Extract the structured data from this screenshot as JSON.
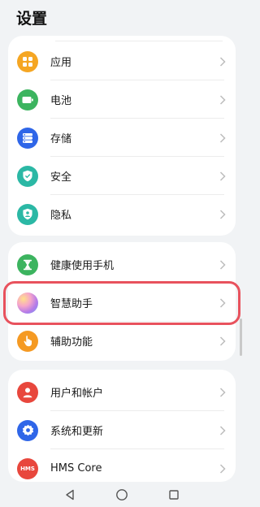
{
  "page": {
    "title": "设置"
  },
  "groups": [
    {
      "items": [
        {
          "label": "应用",
          "icon": "apps-icon",
          "color": "#f5a623"
        },
        {
          "label": "电池",
          "icon": "battery-icon",
          "color": "#3cb45f"
        },
        {
          "label": "存储",
          "icon": "storage-icon",
          "color": "#2f66e8"
        },
        {
          "label": "安全",
          "icon": "shield-icon",
          "color": "#2bb8a5"
        },
        {
          "label": "隐私",
          "icon": "privacy-icon",
          "color": "#2bb8a5"
        }
      ]
    },
    {
      "items": [
        {
          "label": "健康使用手机",
          "icon": "hourglass-icon",
          "color": "#3cb45f"
        },
        {
          "label": "智慧助手",
          "icon": "assistant-orb-icon",
          "color": "#b57be8"
        },
        {
          "label": "辅助功能",
          "icon": "accessibility-hand-icon",
          "color": "#f59a23"
        }
      ]
    },
    {
      "items": [
        {
          "label": "用户和帐户",
          "icon": "user-icon",
          "color": "#e8473d"
        },
        {
          "label": "系统和更新",
          "icon": "gear-icon",
          "color": "#2f66e8"
        },
        {
          "label": "HMS Core",
          "icon": "hms-icon",
          "color": "#e8473d",
          "icon_text": "HMS"
        }
      ]
    }
  ],
  "highlight": {
    "target": "智慧助手",
    "color": "#e8525d"
  },
  "navbar": {
    "buttons": [
      "back-icon",
      "home-icon",
      "recents-icon"
    ]
  }
}
